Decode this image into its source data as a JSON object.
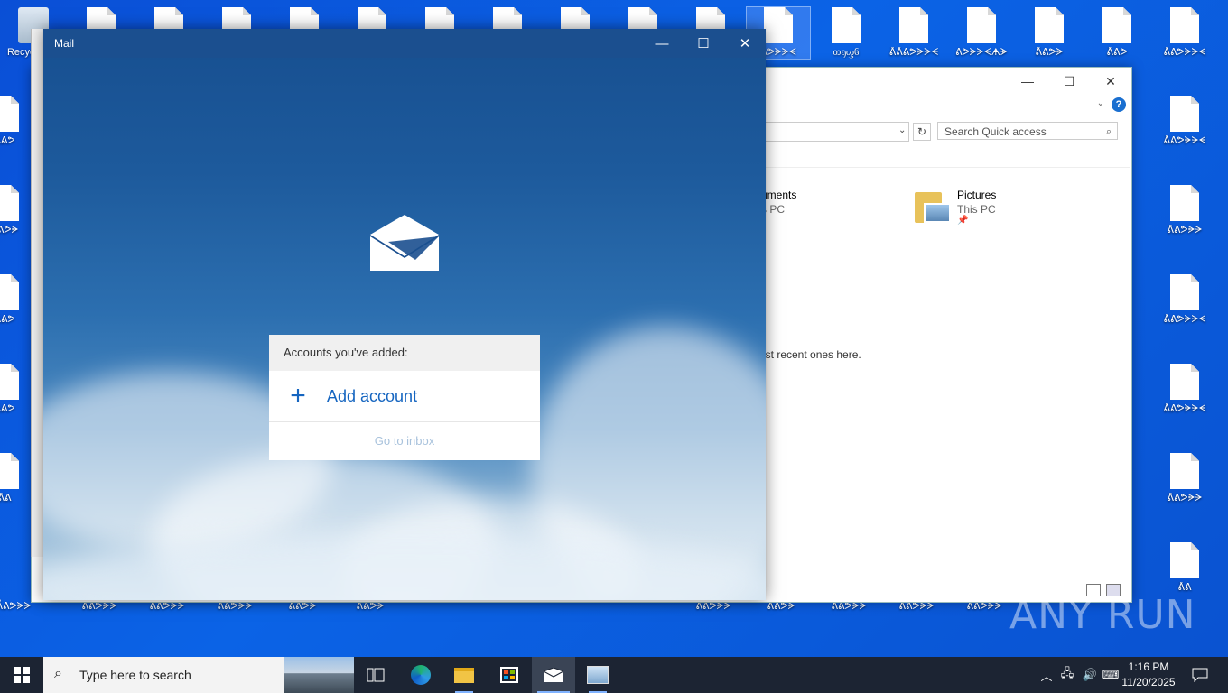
{
  "desktop": {
    "recycle_bin_label": "Recycle Bin",
    "top_row_labels": [
      "",
      "",
      "",
      "",
      "",
      "",
      "",
      "",
      "",
      "",
      "ᕕᕗᗓᗔᗕ",
      "ᦎᦏᦐᦑ",
      "ᕔᕔᕕᕗᗓᗔᗕ",
      "ᕕᕗᗓᗔᗕᗗᗘ",
      "ᕔᕕᕗᗓ",
      "ᕔᕕᕗ",
      "ᕔᕕᕗᗓᗔᗕ"
    ],
    "right_col_labels": [
      "ᕔᕕᕗᗓᗔᗕ",
      "ᕔᕕᕗᗓᗔ",
      "ᕔᕕᕗᗓᗔᗕ",
      "ᕔᕕᕗᗓᗔᗕ",
      "ᕔᕕᕗᗓᗔ",
      "ᕔᕕ"
    ],
    "left_col_labels": [
      "ᕔᕕᕗ",
      "ᕔᕕᕗᗓ",
      "ᕔᕕᕗ",
      "ᕔᕕᕗ",
      "ᕔᕕ"
    ],
    "bottom_row_labels": [
      "ᕔᕕᕗᗓᗔ",
      "ᕔᕕᕗᗓᗔ",
      "ᕔᕕᕗᗓᗔ",
      "ᕔᕕᕗᗓᗔ",
      "ᕔᕕᕗᗓ",
      "ᕔᕕᕗᗓ",
      "ᕔᕕᕗᗓᗔ",
      "ᕔᕕᕗᗓ",
      "ᕔᕕᕗᗓᗔ",
      "ᕔᕕᕗᗓᗔ",
      "ᕔᕕᕗᗓᗔ"
    ]
  },
  "explorer": {
    "search_placeholder": "Search Quick access",
    "items": [
      {
        "name": "Documents",
        "name_visible": "uments",
        "location": "This PC",
        "location_visible": "s PC"
      },
      {
        "name": "Pictures",
        "location": "This PC"
      }
    ],
    "recent_text": "ost recent ones here."
  },
  "mail": {
    "title": "Mail",
    "accounts_header": "Accounts you've added:",
    "add_account": "Add account",
    "go_to_inbox": "Go to inbox"
  },
  "taskbar": {
    "search_placeholder": "Type here to search",
    "apps": [
      "task-view",
      "edge",
      "file-explorer",
      "microsoft-store",
      "mail",
      "control-panel"
    ],
    "time": "1:16 PM",
    "date": "11/20/2025"
  },
  "watermark": "ANY RUN",
  "colors": {
    "accent": "#1565c0",
    "desktop": "#0b5fe0",
    "mail_title": "#1b4f8f",
    "taskbar": "#1c2433"
  }
}
